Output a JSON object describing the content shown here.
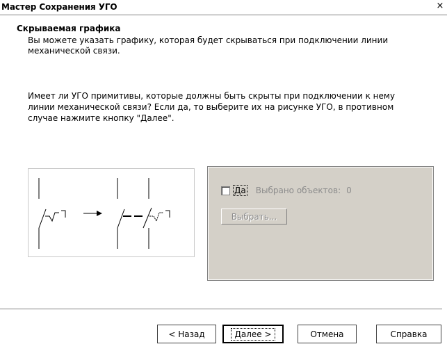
{
  "window": {
    "title": "Мастер Сохранения УГО",
    "close_glyph": "×"
  },
  "header": {
    "title": "Скрываемая графика",
    "description": "Вы можете указать графику, которая будет скрываться при подключении линии механической связи."
  },
  "body": {
    "question": "Имеет ли УГО примитивы, которые должны быть скрыты при подключении к нему линии механической связи? Если да, то выберите их на рисунке УГО, в противном случае нажмите кнопку \"Далее\"."
  },
  "options": {
    "checkbox_label": "Да",
    "checkbox_checked": false,
    "selected_label": "Выбрано объектов:",
    "selected_count": "0",
    "select_button": "Выбрать..."
  },
  "buttons": {
    "back": "< Назад",
    "next": "Далее >",
    "cancel": "Отмена",
    "help": "Справка"
  }
}
